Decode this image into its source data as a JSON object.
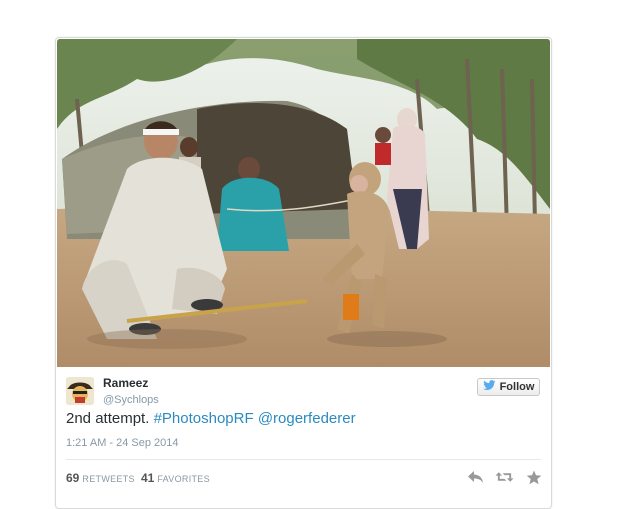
{
  "tweet": {
    "user_name": "Rameez",
    "user_handle": "@Sychlops",
    "follow_label": "Follow",
    "text_plain": "2nd attempt. ",
    "hashtag": "#PhotoshopRF",
    "mention": "@rogerfederer",
    "timestamp": "1:21 AM - 24 Sep 2014",
    "retweets_count": "69",
    "retweets_label": "Retweets",
    "favorites_count": "41",
    "favorites_label": "Favorites"
  },
  "icons": {
    "follow": "twitter-bird-icon",
    "reply": "reply-icon",
    "retweet": "retweet-icon",
    "favorite": "star-icon"
  },
  "colors": {
    "link": "#2a8bbf",
    "muted": "#8899a6",
    "text": "#292f33",
    "twitter_blue": "#55acee"
  }
}
